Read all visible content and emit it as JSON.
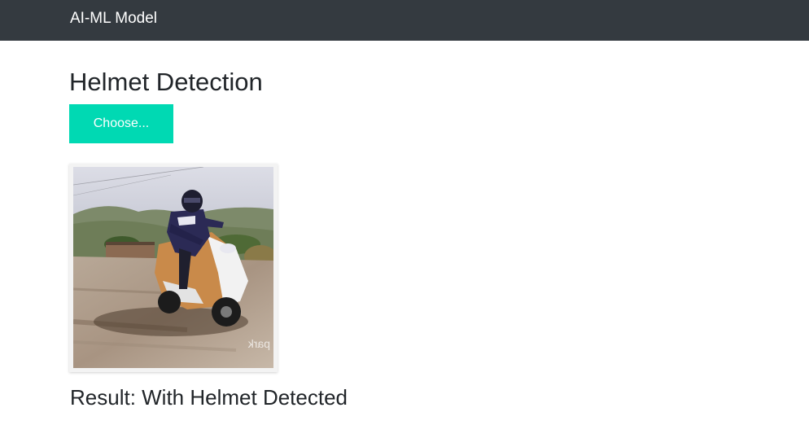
{
  "navbar": {
    "brand": "AI-ML Model"
  },
  "main": {
    "title": "Helmet Detection",
    "choose_label": "Choose...",
    "preview": {
      "watermark": "park"
    },
    "result_text": "Result: With Helmet Detected"
  },
  "colors": {
    "navbar_bg": "#343a40",
    "button_bg": "#00d9b3",
    "text": "#212529"
  }
}
